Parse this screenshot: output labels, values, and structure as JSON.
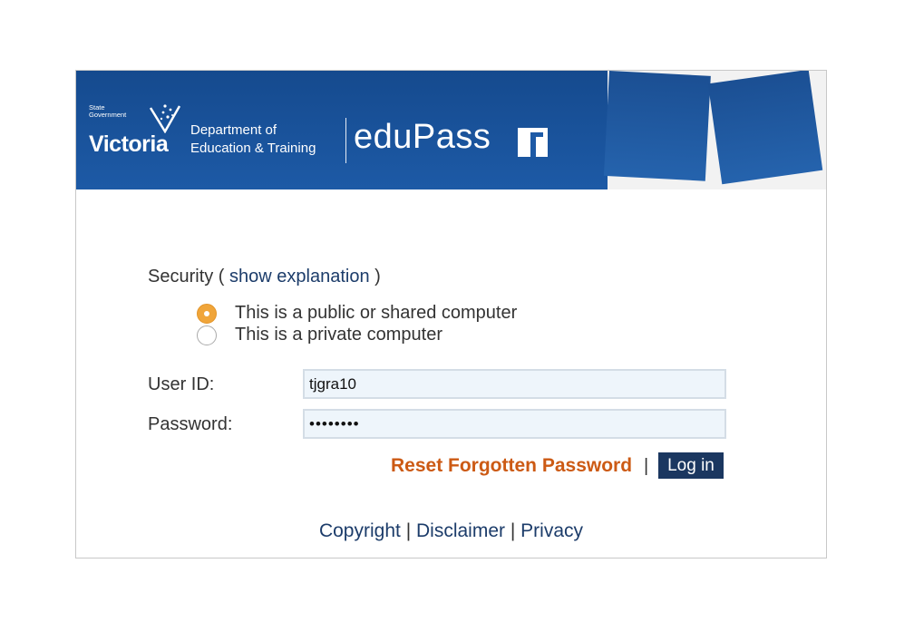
{
  "header": {
    "logo_small_line1": "State",
    "logo_small_line2": "Government",
    "logo_big": "Victoria",
    "dept_line1": "Department of",
    "dept_line2": "Education & Training",
    "brand": "eduPass"
  },
  "security": {
    "label": "Security (",
    "link": "show explanation",
    "close": ")",
    "options": [
      {
        "label": "This is a public or shared computer",
        "selected": true
      },
      {
        "label": "This is a private computer",
        "selected": false
      }
    ]
  },
  "form": {
    "user_label": "User ID:",
    "user_value": "tjgra10",
    "password_label": "Password:",
    "password_value": "••••••••"
  },
  "actions": {
    "reset_label": "Reset Forgotten Password",
    "separator": "|",
    "login_label": "Log in"
  },
  "footer": {
    "copyright": "Copyright",
    "disclaimer": "Disclaimer",
    "privacy": "Privacy",
    "separator": "|"
  },
  "colors": {
    "brand_blue": "#1d5aa6",
    "link_blue": "#1c3c6a",
    "reset_orange": "#cc5a14",
    "radio_selected": "#f0a53a",
    "button_navy": "#1b3760"
  }
}
